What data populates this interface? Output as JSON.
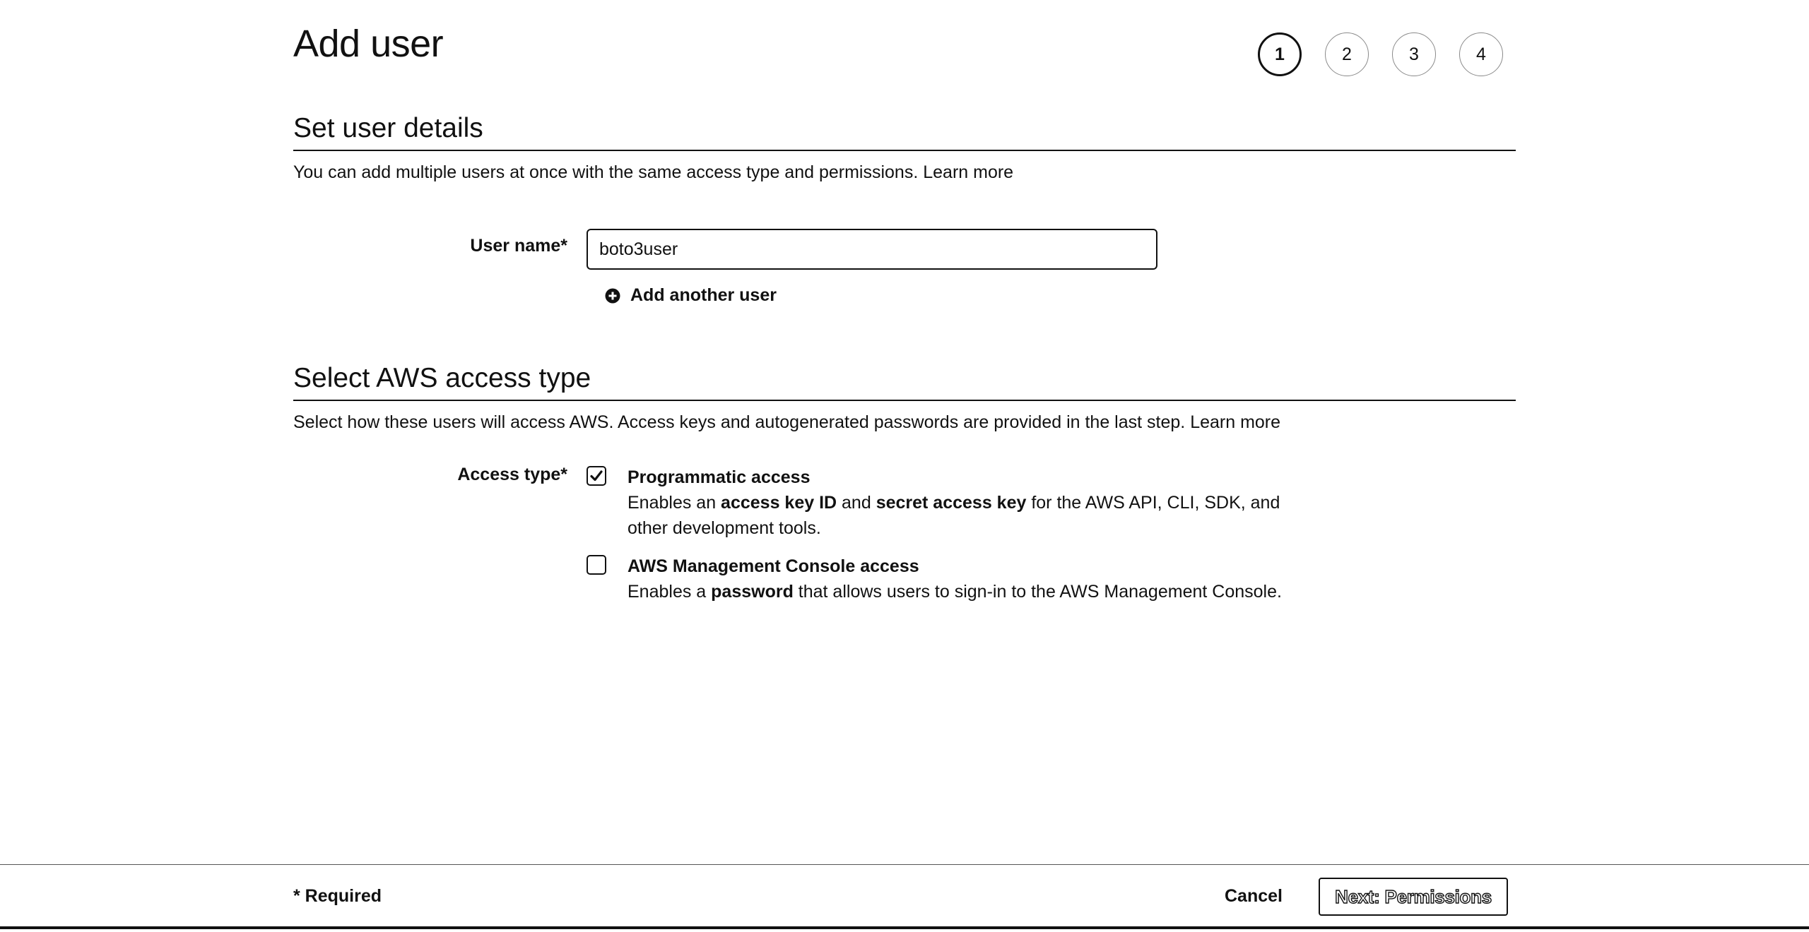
{
  "page": {
    "title": "Add user"
  },
  "steps": [
    "1",
    "2",
    "3",
    "4"
  ],
  "user_details": {
    "title": "Set user details",
    "description": "You can add multiple users at once with the same access type and permissions.",
    "learn_more": "Learn more",
    "user_name_label": "User name*",
    "user_name_value": "boto3user",
    "add_another_label": "Add another user"
  },
  "access_type": {
    "title": "Select AWS access type",
    "description": "Select how these users will access AWS. Access keys and autogenerated passwords are provided in the last step.",
    "learn_more": "Learn more",
    "label": "Access type*",
    "programmatic": {
      "title": "Programmatic access",
      "checked": true,
      "desc_prefix": "Enables an ",
      "desc_bold1": "access key ID",
      "desc_mid": " and ",
      "desc_bold2": "secret access key",
      "desc_suffix": " for the AWS API, CLI, SDK, and other development tools."
    },
    "console": {
      "title": "AWS Management Console access",
      "checked": false,
      "desc_prefix": "Enables a ",
      "desc_bold": "password",
      "desc_suffix": " that allows users to sign-in to the AWS Management Console."
    }
  },
  "footer": {
    "required": "* Required",
    "cancel": "Cancel",
    "next": "Next: Permissions"
  },
  "icons": {
    "add": "plus-circle-icon",
    "check": "check-icon"
  }
}
